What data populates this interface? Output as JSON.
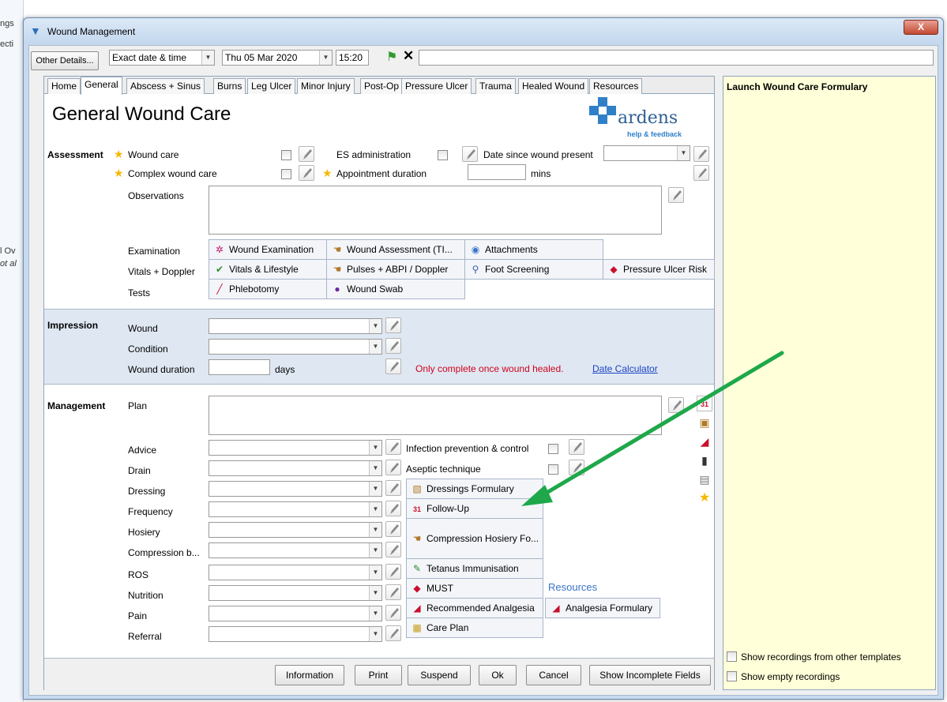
{
  "background": {
    "snips": [
      "ngs",
      "ecti",
      "l Ov",
      "ot al"
    ]
  },
  "window": {
    "title": "Wound Management",
    "close": "X"
  },
  "topbar": {
    "other_details": "Other Details...",
    "date_mode": "Exact date & time",
    "date": "Thu 05 Mar 2020",
    "time": "15:20",
    "flag": "⚑",
    "clear": "✕",
    "note": ""
  },
  "tabs": [
    "Home",
    "General",
    "Abscess + Sinus",
    "Burns",
    "Leg Ulcer",
    "Minor Injury",
    "Post-Op",
    "Pressure Ulcer",
    "Trauma",
    "Healed Wound",
    "Resources"
  ],
  "heading": "General Wound Care",
  "logo": {
    "name": "ardens",
    "sub": "help & feedback"
  },
  "assessment": {
    "label": "Assessment",
    "wound_care": "Wound care",
    "complex_wound_care": "Complex wound care",
    "es_admin": "ES administration",
    "date_since": "Date since wound present",
    "appointment": "Appointment duration",
    "mins": "mins",
    "observations": "Observations",
    "examination": "Examination",
    "vitals": "Vitals + Doppler",
    "tests": "Tests"
  },
  "buttons_grid": {
    "wound_exam": "Wound Examination",
    "wound_assess": "Wound Assessment (TI...",
    "attachments": "Attachments",
    "vitals_lifestyle": "Vitals & Lifestyle",
    "pulses": "Pulses + ABPI / Doppler",
    "foot": "Foot Screening",
    "pressure_risk": "Pressure Ulcer Risk",
    "phlebotomy": "Phlebotomy",
    "swab": "Wound Swab"
  },
  "impression": {
    "label": "Impression",
    "wound": "Wound",
    "condition": "Condition",
    "duration": "Wound duration",
    "days": "days",
    "note": "Only complete once wound healed.",
    "calc": "Date Calculator"
  },
  "management": {
    "label": "Management",
    "plan": "Plan",
    "rows": [
      "Advice",
      "Drain",
      "Dressing",
      "Frequency",
      "Hosiery",
      "Compression b...",
      "ROS",
      "Nutrition",
      "Pain",
      "Referral"
    ],
    "infection": "Infection prevention & control",
    "aseptic": "Aseptic technique",
    "dressings_formulary": "Dressings Formulary",
    "follow_up": "Follow-Up",
    "compression": "Compression Hosiery Fo...",
    "tetanus": "Tetanus Immunisation",
    "must": "MUST",
    "analgesia": "Recommended Analgesia",
    "resources": "Resources",
    "analgesia_formulary": "Analgesia Formulary",
    "care_plan": "Care Plan"
  },
  "footer": {
    "information": "Information",
    "print": "Print",
    "suspend": "Suspend",
    "ok": "Ok",
    "cancel": "Cancel",
    "incomplete": "Show Incomplete Fields"
  },
  "side": {
    "title": "Launch Wound Care Formulary",
    "show_other": "Show recordings from other templates",
    "show_empty": "Show empty recordings"
  },
  "colors": {
    "accent": "#1a44c4",
    "warning": "#d0021b",
    "arrow": "#1ea84a"
  }
}
